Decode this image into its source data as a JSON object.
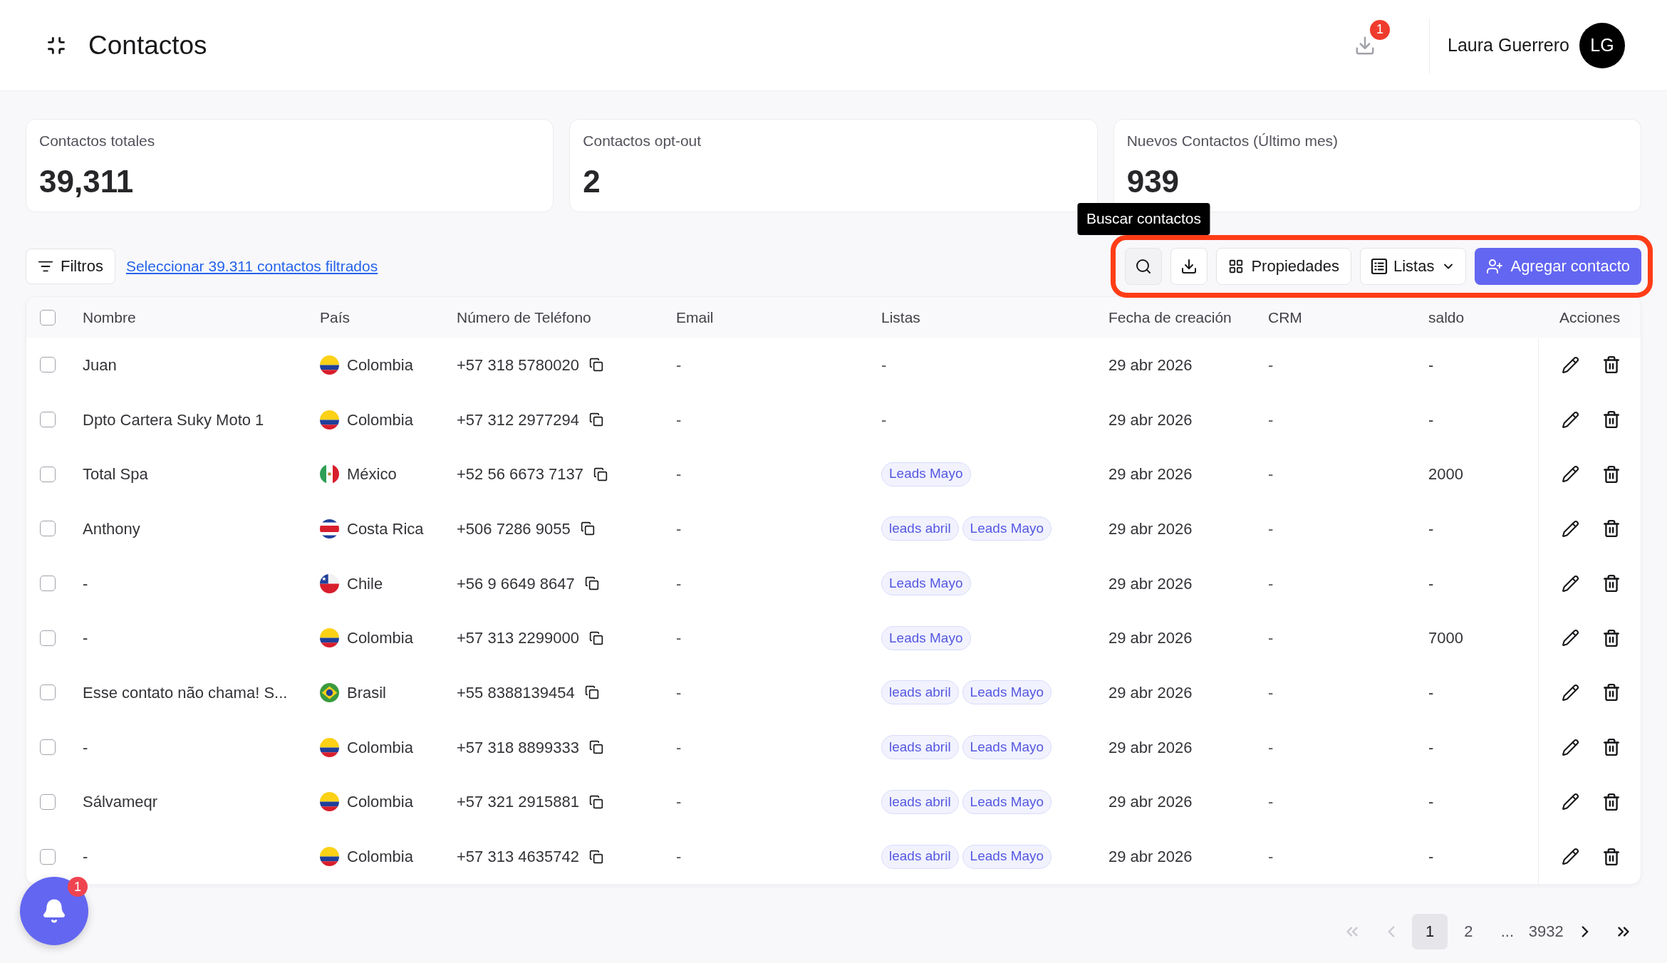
{
  "header": {
    "title": "Contactos",
    "downloads_badge": "1",
    "user_name": "Laura Guerrero",
    "user_initials": "LG"
  },
  "stats": [
    {
      "label": "Contactos totales",
      "value": "39,311"
    },
    {
      "label": "Contactos opt-out",
      "value": "2"
    },
    {
      "label": "Nuevos Contactos (Último mes)",
      "value": "939"
    }
  ],
  "toolbar": {
    "filter_button": "Filtros",
    "select_link": "Seleccionar 39.311 contactos filtrados",
    "highlighted": true,
    "icon_buttons": [
      {
        "kind": "search",
        "hovered": true,
        "tooltip": "Buscar contactos"
      },
      {
        "kind": "download",
        "hovered": false
      }
    ],
    "properties_button": "Propiedades",
    "lists_button": "Listas",
    "add_button": "Agregar contacto"
  },
  "table": {
    "select_all": {
      "checked": false
    },
    "columns": [
      "Nombre",
      "País",
      "Número de Teléfono",
      "Email",
      "Listas",
      "Fecha de creación",
      "CRM",
      "saldo",
      "Acciones"
    ],
    "rows": [
      {
        "checked": false,
        "name": "Juan",
        "country": "Colombia",
        "flag": {
          "kind": "co"
        },
        "phone": "+57 318 5780020",
        "email": "-",
        "lists_text": "-",
        "created": "29 abr 2026",
        "crm": "-",
        "saldo": "-"
      },
      {
        "checked": false,
        "name": "Dpto Cartera Suky Moto 1",
        "country": "Colombia",
        "flag": {
          "kind": "co"
        },
        "phone": "+57 312 2977294",
        "email": "-",
        "lists_text": "-",
        "created": "29 abr 2026",
        "crm": "-",
        "saldo": "-"
      },
      {
        "checked": false,
        "name": "Total Spa",
        "country": "México",
        "flag": {
          "kind": "mx"
        },
        "phone": "+52 56 6673 7137",
        "email": "-",
        "lists": [
          "Leads Mayo"
        ],
        "created": "29 abr 2026",
        "crm": "-",
        "saldo": "2000"
      },
      {
        "checked": false,
        "name": "Anthony",
        "country": "Costa Rica",
        "flag": {
          "kind": "cr"
        },
        "phone": "+506 7286 9055",
        "email": "-",
        "lists": [
          "leads abril",
          "Leads Mayo"
        ],
        "created": "29 abr 2026",
        "crm": "-",
        "saldo": "-"
      },
      {
        "checked": false,
        "name": "-",
        "country": "Chile",
        "flag": {
          "kind": "cl"
        },
        "phone": "+56 9 6649 8647",
        "email": "-",
        "lists": [
          "Leads Mayo"
        ],
        "created": "29 abr 2026",
        "crm": "-",
        "saldo": "-"
      },
      {
        "checked": false,
        "name": "-",
        "country": "Colombia",
        "flag": {
          "kind": "co"
        },
        "phone": "+57 313 2299000",
        "email": "-",
        "lists": [
          "Leads Mayo"
        ],
        "created": "29 abr 2026",
        "crm": "-",
        "saldo": "7000"
      },
      {
        "checked": false,
        "name": "Esse contato não chama! S...",
        "country": "Brasil",
        "flag": {
          "kind": "br"
        },
        "phone": "+55 8388139454",
        "email": "-",
        "lists": [
          "leads abril",
          "Leads Mayo"
        ],
        "created": "29 abr 2026",
        "crm": "-",
        "saldo": "-"
      },
      {
        "checked": false,
        "name": "-",
        "country": "Colombia",
        "flag": {
          "kind": "co"
        },
        "phone": "+57 318 8899333",
        "email": "-",
        "lists": [
          "leads abril",
          "Leads Mayo"
        ],
        "created": "29 abr 2026",
        "crm": "-",
        "saldo": "-"
      },
      {
        "checked": false,
        "name": "Sálvameqr",
        "country": "Colombia",
        "flag": {
          "kind": "co"
        },
        "phone": "+57 321 2915881",
        "email": "-",
        "lists": [
          "leads abril",
          "Leads Mayo"
        ],
        "created": "29 abr 2026",
        "crm": "-",
        "saldo": "-"
      },
      {
        "checked": false,
        "name": "-",
        "country": "Colombia",
        "flag": {
          "kind": "co"
        },
        "phone": "+57 313 4635742",
        "email": "-",
        "lists": [
          "leads abril",
          "Leads Mayo"
        ],
        "created": "29 abr 2026",
        "crm": "-",
        "saldo": "-"
      }
    ]
  },
  "pagination": {
    "items": [
      {
        "kind": "first",
        "disabled": true
      },
      {
        "kind": "prev",
        "disabled": true
      },
      {
        "kind": "page",
        "label": "1",
        "selected": true
      },
      {
        "kind": "page",
        "label": "2",
        "selected": false
      },
      {
        "kind": "ellipsis",
        "label": "..."
      },
      {
        "kind": "page",
        "label": "3932",
        "selected": false
      },
      {
        "kind": "next",
        "disabled": false
      },
      {
        "kind": "last",
        "disabled": false
      }
    ]
  },
  "notifications": {
    "badge": "1"
  }
}
